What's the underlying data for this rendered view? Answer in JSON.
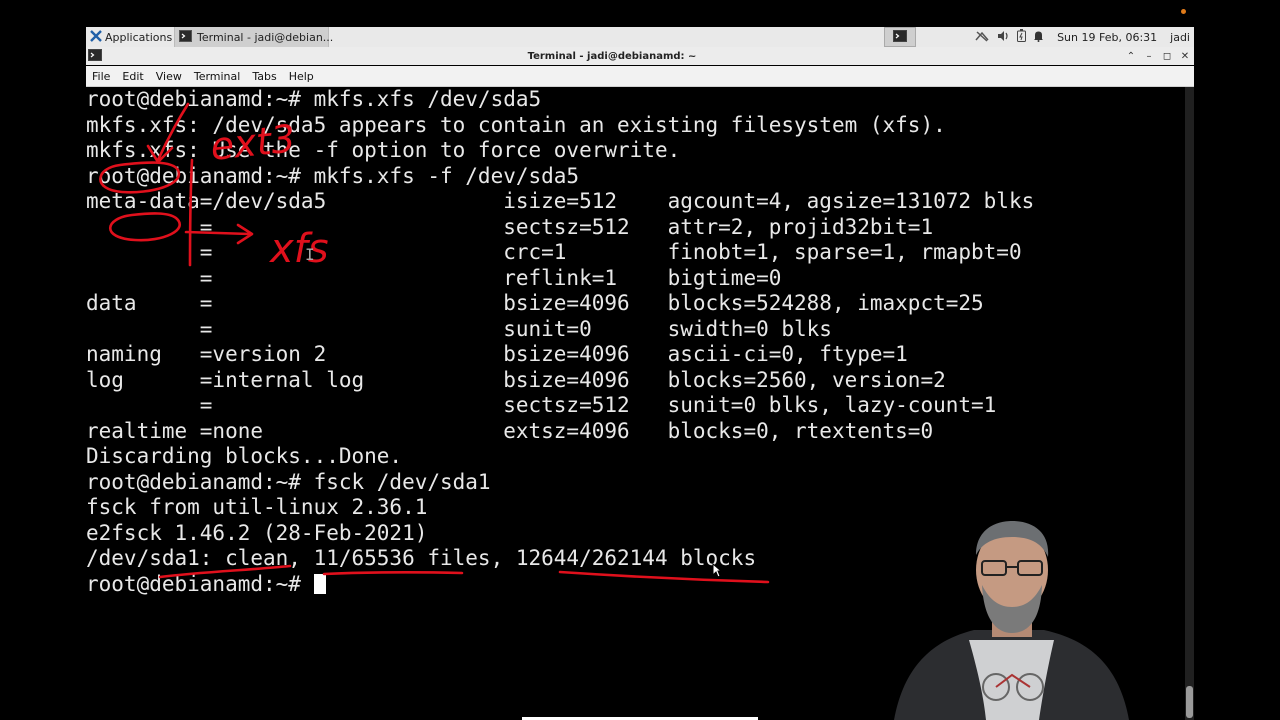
{
  "panel": {
    "applications_label": "Applications",
    "task_label": "Terminal - jadi@debian...",
    "datetime": "Sun 19 Feb, 06:31",
    "user": "jadi"
  },
  "window": {
    "title": "Terminal - jadi@debianamd: ~"
  },
  "menu": {
    "items": [
      "File",
      "Edit",
      "View",
      "Terminal",
      "Tabs",
      "Help"
    ]
  },
  "terminal": {
    "lines": [
      "root@debianamd:~# mkfs.xfs /dev/sda5",
      "mkfs.xfs: /dev/sda5 appears to contain an existing filesystem (xfs).",
      "mkfs.xfs: Use the -f option to force overwrite.",
      "root@debianamd:~# mkfs.xfs -f /dev/sda5",
      "meta-data=/dev/sda5              isize=512    agcount=4, agsize=131072 blks",
      "         =                       sectsz=512   attr=2, projid32bit=1",
      "         =                       crc=1        finobt=1, sparse=1, rmapbt=0",
      "         =                       reflink=1    bigtime=0",
      "data     =                       bsize=4096   blocks=524288, imaxpct=25",
      "         =                       sunit=0      swidth=0 blks",
      "naming   =version 2              bsize=4096   ascii-ci=0, ftype=1",
      "log      =internal log           bsize=4096   blocks=2560, version=2",
      "         =                       sectsz=512   sunit=0 blks, lazy-count=1",
      "realtime =none                   extsz=4096   blocks=0, rtextents=0",
      "Discarding blocks...Done.",
      "root@debianamd:~# fsck /dev/sda1",
      "fsck from util-linux 2.36.1",
      "e2fsck 1.46.2 (28-Feb-2021)",
      "/dev/sda1: clean, 11/65536 files, 12644/262144 blocks"
    ],
    "prompt": "root@debianamd:~# "
  },
  "annotations": {
    "word_1": "ext3",
    "word_2": "xfs"
  },
  "colors": {
    "annotation": "#e0101c",
    "terminal_bg": "#000000",
    "terminal_fg": "#e8e8e8"
  }
}
